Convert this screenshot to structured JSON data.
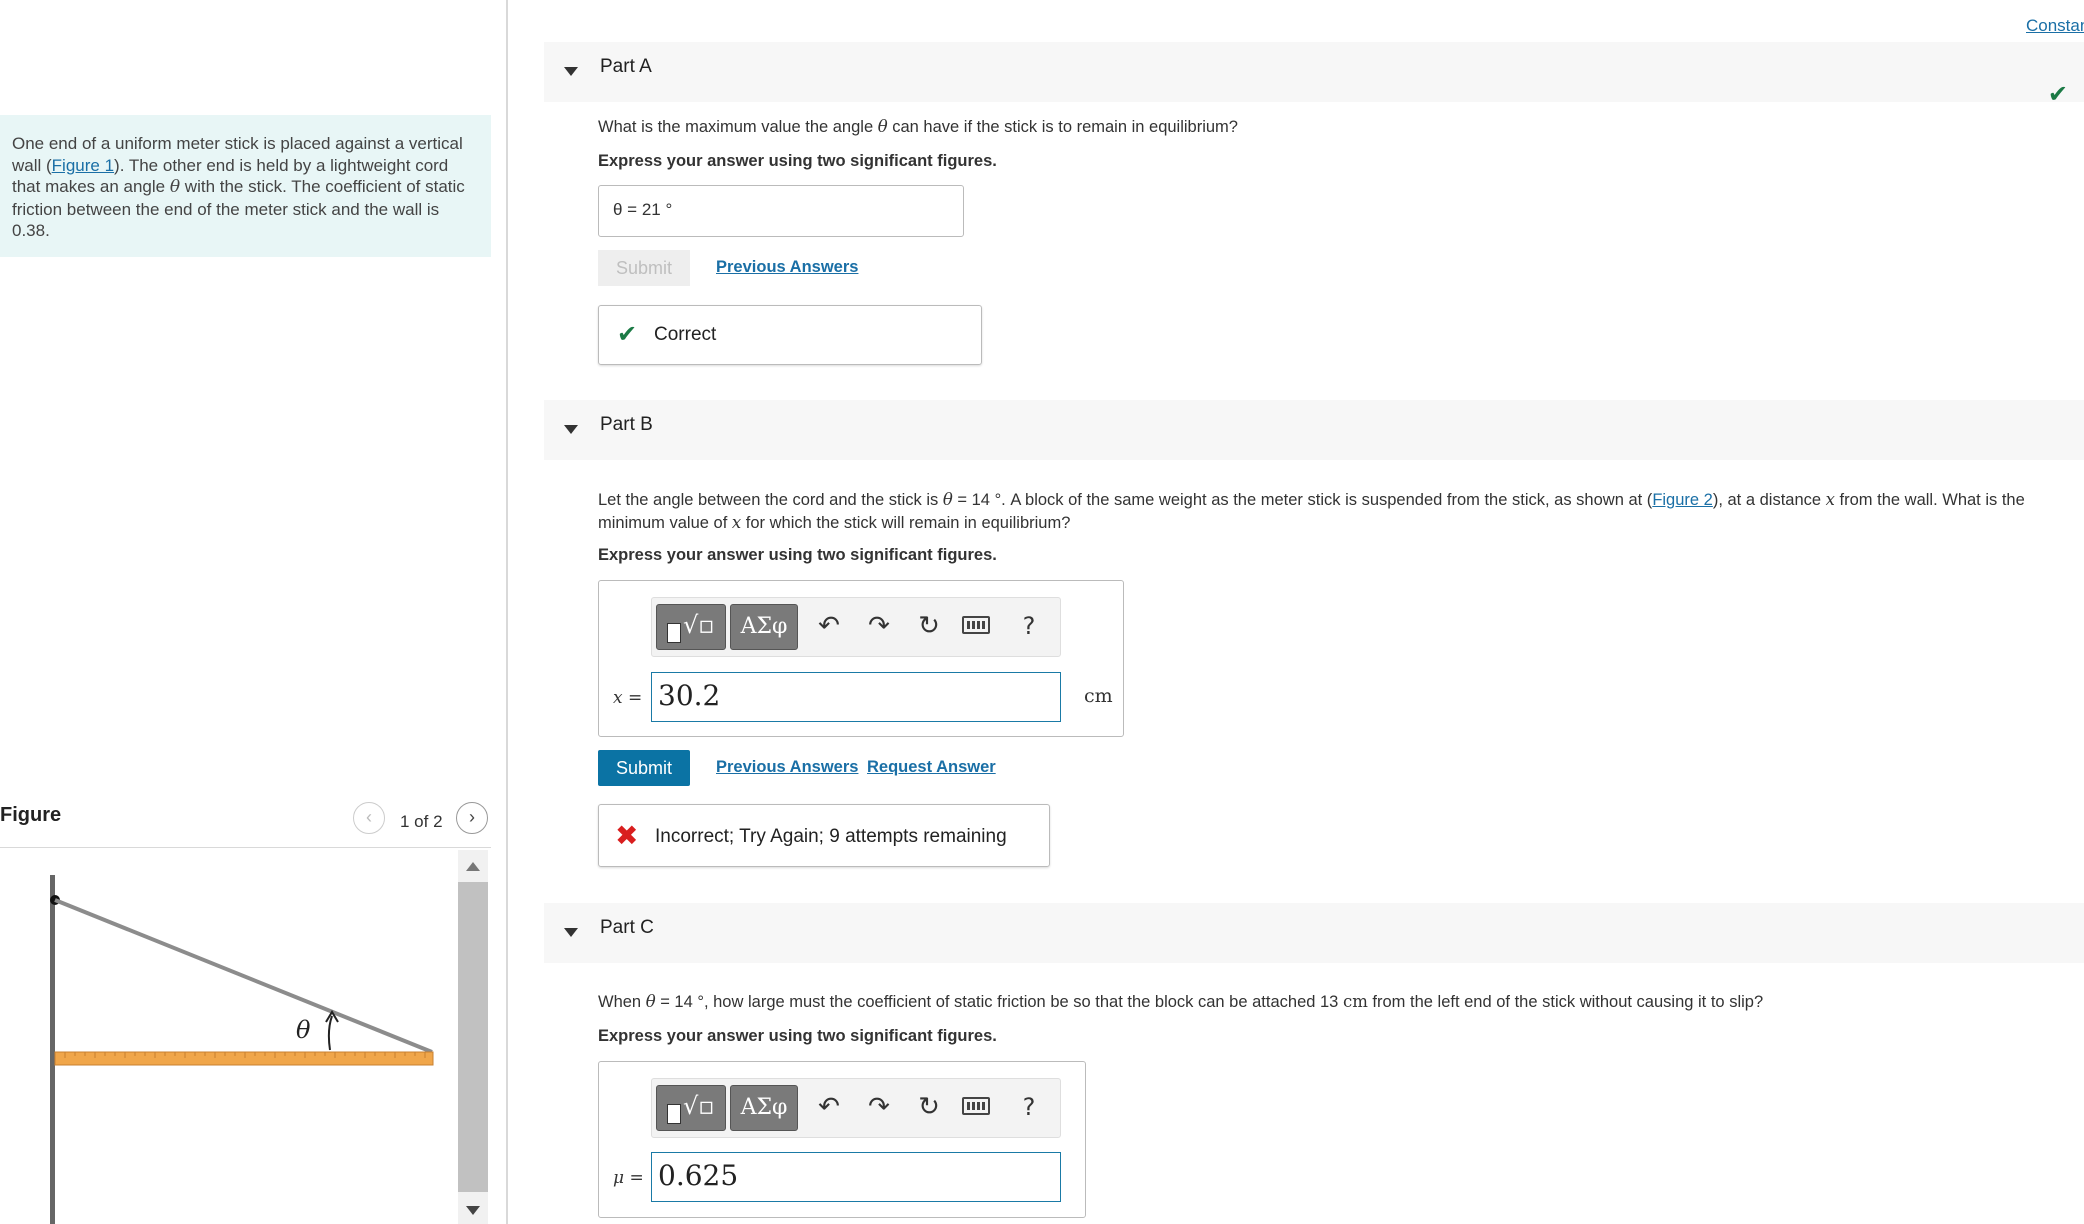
{
  "problem": {
    "text_before": "One end of a uniform meter stick is placed against a vertical wall (",
    "figure_link": "Figure 1",
    "text_mid": "). The other end is held by a lightweight cord that makes an angle ",
    "theta": "θ",
    "text_after": " with the stick. The coefficient of static friction between the end of the meter stick and the wall is 0.38."
  },
  "figure_panel": {
    "title": "Figure",
    "counter": "1 of 2",
    "prev_icon": "‹",
    "next_icon": "›",
    "angle_label": "θ"
  },
  "constants_link": "Constants",
  "part_a": {
    "title": "Part A",
    "question_before": "What is the maximum value the angle ",
    "theta": "θ",
    "question_after": " can have if the stick is to remain in equilibrium?",
    "instruction": "Express your answer using two significant figures.",
    "answer": "θ =  21  °",
    "submit_label": "Submit",
    "previous_answers": "Previous Answers",
    "feedback": "Correct",
    "check_icon": "✔"
  },
  "part_b": {
    "title": "Part B",
    "question_1": "Let the angle between the cord and the stick is ",
    "theta": "θ",
    "question_2": " = 14 °. A block of the same weight as the meter stick is suspended from the stick, as shown at (",
    "figure_link": "Figure 2",
    "question_3": "), at a distance ",
    "x_var": "x",
    "question_4": " from the wall. What is the minimum value of ",
    "question_5": " for which the stick will remain in equilibrium?",
    "instruction": "Express your answer using two significant figures.",
    "label": "x =",
    "input_value": "30.2",
    "unit": "cm",
    "toolbar_greek": "ΑΣφ",
    "toolbar_help": "?",
    "submit_label": "Submit",
    "previous_answers": "Previous Answers",
    "request_answer": "Request Answer",
    "feedback": "Incorrect; Try Again; 9 attempts remaining",
    "feedback_icon": "✖"
  },
  "part_c": {
    "title": "Part C",
    "question_1": "When ",
    "theta": "θ",
    "question_2": " = 14 °, how large must the coefficient of static friction be so that the block can be attached 13 ",
    "unit_cm": "cm",
    "question_3": " from the left end of the stick without causing it to slip?",
    "instruction": "Express your answer using two significant figures.",
    "label": "μ =",
    "input_value": "0.625",
    "toolbar_greek": "ΑΣφ",
    "toolbar_help": "?"
  },
  "colors": {
    "accent": "#0b73a4",
    "correct": "#1b7a45",
    "incorrect": "#d91e1e",
    "problem_bg": "#e8f6f6",
    "ruler": "#f0a64a"
  }
}
